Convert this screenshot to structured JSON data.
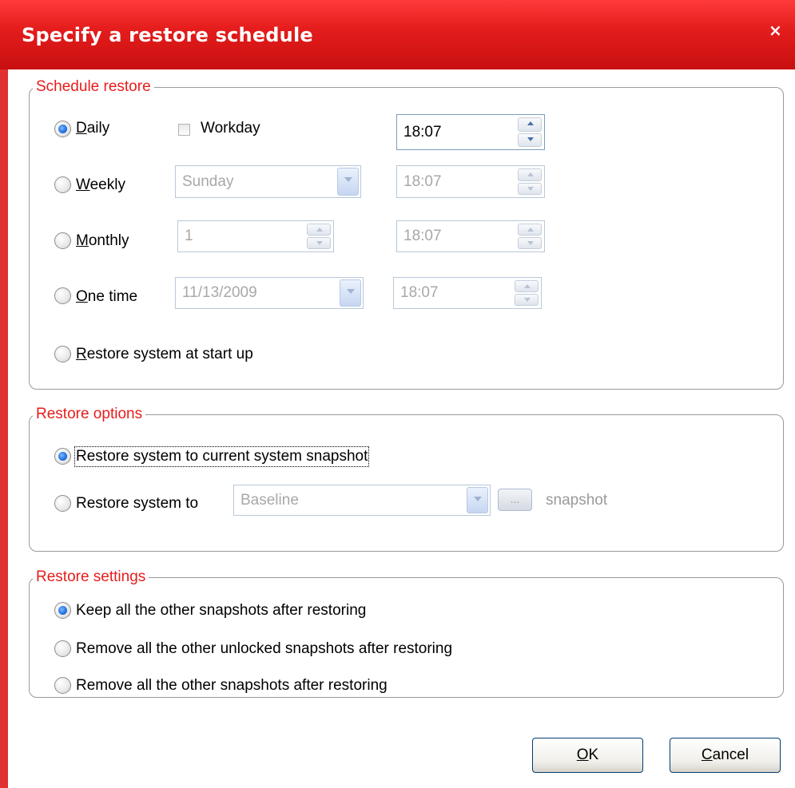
{
  "dialog": {
    "title": "Specify a restore schedule",
    "close_glyph": "×"
  },
  "schedule": {
    "legend": "Schedule restore",
    "daily": {
      "label_pre": "",
      "label_u": "D",
      "label_post": "aily",
      "selected": true
    },
    "workday": {
      "label": "Workday",
      "checked": false
    },
    "daily_time": "18:07",
    "weekly": {
      "label_u": "W",
      "label_post": "eekly",
      "day": "Sunday",
      "time": "18:07"
    },
    "monthly": {
      "label_u": "M",
      "label_post": "onthly",
      "day": "1",
      "time": "18:07"
    },
    "onetime": {
      "label_u": "O",
      "label_post": "ne time",
      "date": "11/13/2009",
      "time": "18:07"
    },
    "startup": {
      "label_u": "R",
      "label_post": "estore system at start up"
    }
  },
  "restore_options": {
    "legend": "Restore options",
    "current": {
      "label": "Restore system to current system snapshot",
      "selected": true
    },
    "to": {
      "label": "Restore system to",
      "value": "Baseline",
      "browse": "...",
      "suffix": "snapshot"
    }
  },
  "restore_settings": {
    "legend": "Restore settings",
    "items": [
      {
        "label": "Keep all the other snapshots after restoring",
        "selected": true
      },
      {
        "label": "Remove all the other unlocked snapshots after restoring",
        "selected": false
      },
      {
        "label": "Remove all the other snapshots after restoring",
        "selected": false
      }
    ]
  },
  "buttons": {
    "ok": {
      "u": "O",
      "rest": "K"
    },
    "cancel": {
      "u": "C",
      "rest": "ancel"
    }
  },
  "colors": {
    "title_bar": "#e51d1d",
    "legend_text": "#e81c1c",
    "radio_dot": "#1d6fe0"
  }
}
